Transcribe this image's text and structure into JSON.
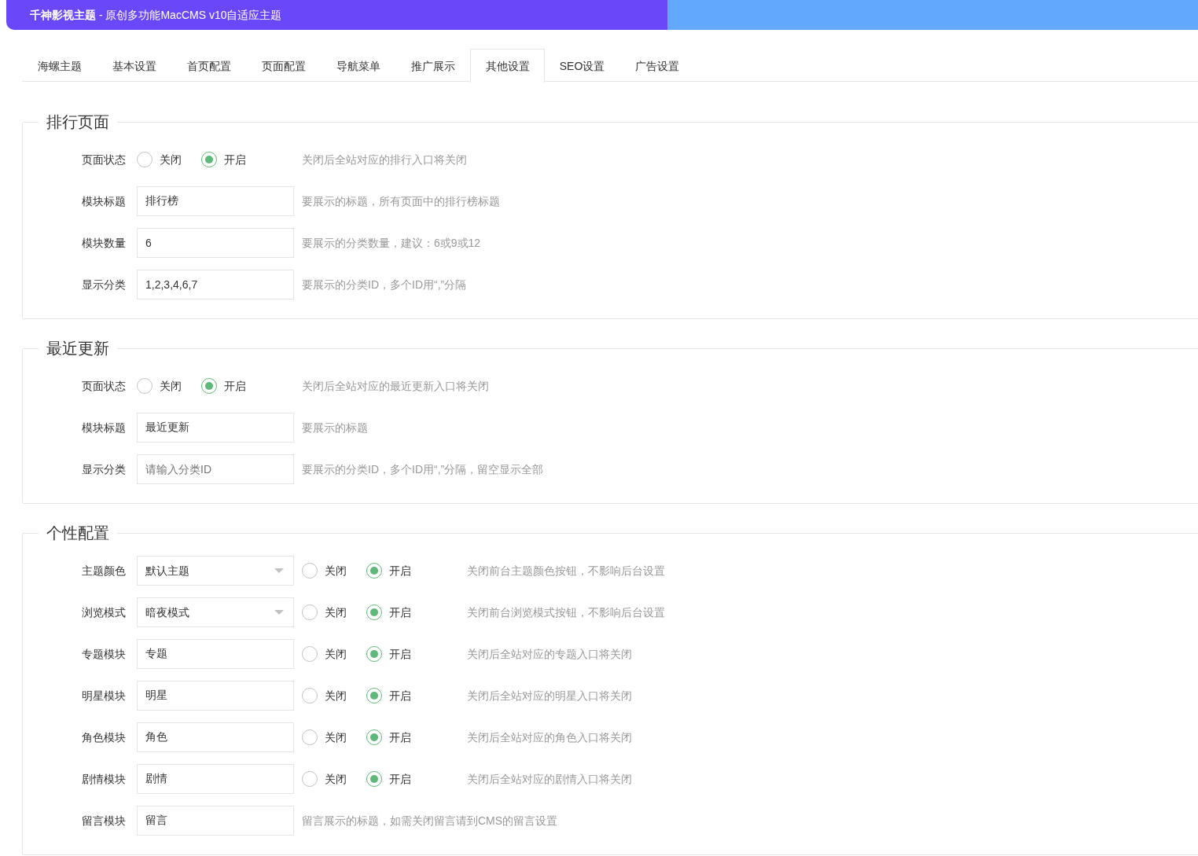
{
  "header": {
    "title": "**千神影视主题** - 原创多功能MacCMS v10自适应主题"
  },
  "tabs": [
    {
      "label": "海螺主题",
      "selected": false
    },
    {
      "label": "基本设置",
      "selected": false
    },
    {
      "label": "首页配置",
      "selected": false
    },
    {
      "label": "页面配置",
      "selected": false
    },
    {
      "label": "导航菜单",
      "selected": false
    },
    {
      "label": "推广展示",
      "selected": false
    },
    {
      "label": "其他设置",
      "selected": true
    },
    {
      "label": "SEO设置",
      "selected": false
    },
    {
      "label": "广告设置",
      "selected": false
    }
  ],
  "sections": [
    {
      "title": "排行页面",
      "rows": [
        {
          "label": "页面状态",
          "options": [
            {
              "label": "关闭",
              "selected": false
            },
            {
              "label": "开启",
              "selected": true
            }
          ],
          "hint": "关闭后全站对应的排行入口将关闭"
        },
        {
          "label": "模块标题",
          "field": {
            "kind": "text",
            "value": "排行榜"
          },
          "hint": "要展示的标题，所有页面中的排行榜标题"
        },
        {
          "label": "模块数量",
          "field": {
            "kind": "text",
            "value": "6"
          },
          "hint": "要展示的分类数量，建议：6或9或12"
        },
        {
          "label": "显示分类",
          "field": {
            "kind": "text",
            "value": "1,2,3,4,6,7"
          },
          "hint": "要展示的分类ID，多个ID用“,”分隔"
        }
      ]
    },
    {
      "title": "最近更新",
      "rows": [
        {
          "label": "页面状态",
          "options": [
            {
              "label": "关闭",
              "selected": false
            },
            {
              "label": "开启",
              "selected": true
            }
          ],
          "hint": "关闭后全站对应的最近更新入口将关闭"
        },
        {
          "label": "模块标题",
          "field": {
            "kind": "text",
            "value": "最近更新"
          },
          "hint": "要展示的标题"
        },
        {
          "label": "显示分类",
          "field": {
            "kind": "text",
            "placeholder": "请输入分类ID"
          },
          "hint": "要展示的分类ID，多个ID用“,”分隔，留空显示全部"
        }
      ]
    },
    {
      "title": "个性配置",
      "rows": [
        {
          "label": "主题颜色",
          "field": {
            "kind": "select",
            "value": "默认主题"
          },
          "options": [
            {
              "label": "关闭",
              "selected": false
            },
            {
              "label": "开启",
              "selected": true
            }
          ],
          "hint": "关闭前台主题颜色按钮，不影响后台设置"
        },
        {
          "label": "浏览模式",
          "field": {
            "kind": "select",
            "value": "暗夜模式"
          },
          "options": [
            {
              "label": "关闭",
              "selected": false
            },
            {
              "label": "开启",
              "selected": true
            }
          ],
          "hint": "关闭前台浏览模式按钮，不影响后台设置"
        },
        {
          "label": "专题模块",
          "field": {
            "kind": "text",
            "value": "专题"
          },
          "options": [
            {
              "label": "关闭",
              "selected": false
            },
            {
              "label": "开启",
              "selected": true
            }
          ],
          "hint": "关闭后全站对应的专题入口将关闭"
        },
        {
          "label": "明星模块",
          "field": {
            "kind": "text",
            "value": "明星"
          },
          "options": [
            {
              "label": "关闭",
              "selected": false
            },
            {
              "label": "开启",
              "selected": true
            }
          ],
          "hint": "关闭后全站对应的明星入口将关闭"
        },
        {
          "label": "角色模块",
          "field": {
            "kind": "text",
            "value": "角色"
          },
          "options": [
            {
              "label": "关闭",
              "selected": false
            },
            {
              "label": "开启",
              "selected": true
            }
          ],
          "hint": "关闭后全站对应的角色入口将关闭"
        },
        {
          "label": "剧情模块",
          "field": {
            "kind": "text",
            "value": "剧情"
          },
          "options": [
            {
              "label": "关闭",
              "selected": false
            },
            {
              "label": "开启",
              "selected": true
            }
          ],
          "hint": "关闭后全站对应的剧情入口将关闭"
        },
        {
          "label": "留言模块",
          "field": {
            "kind": "text",
            "value": "留言"
          },
          "hint": "留言展示的标题，如需关闭留言请到CMS的留言设置"
        }
      ]
    }
  ]
}
